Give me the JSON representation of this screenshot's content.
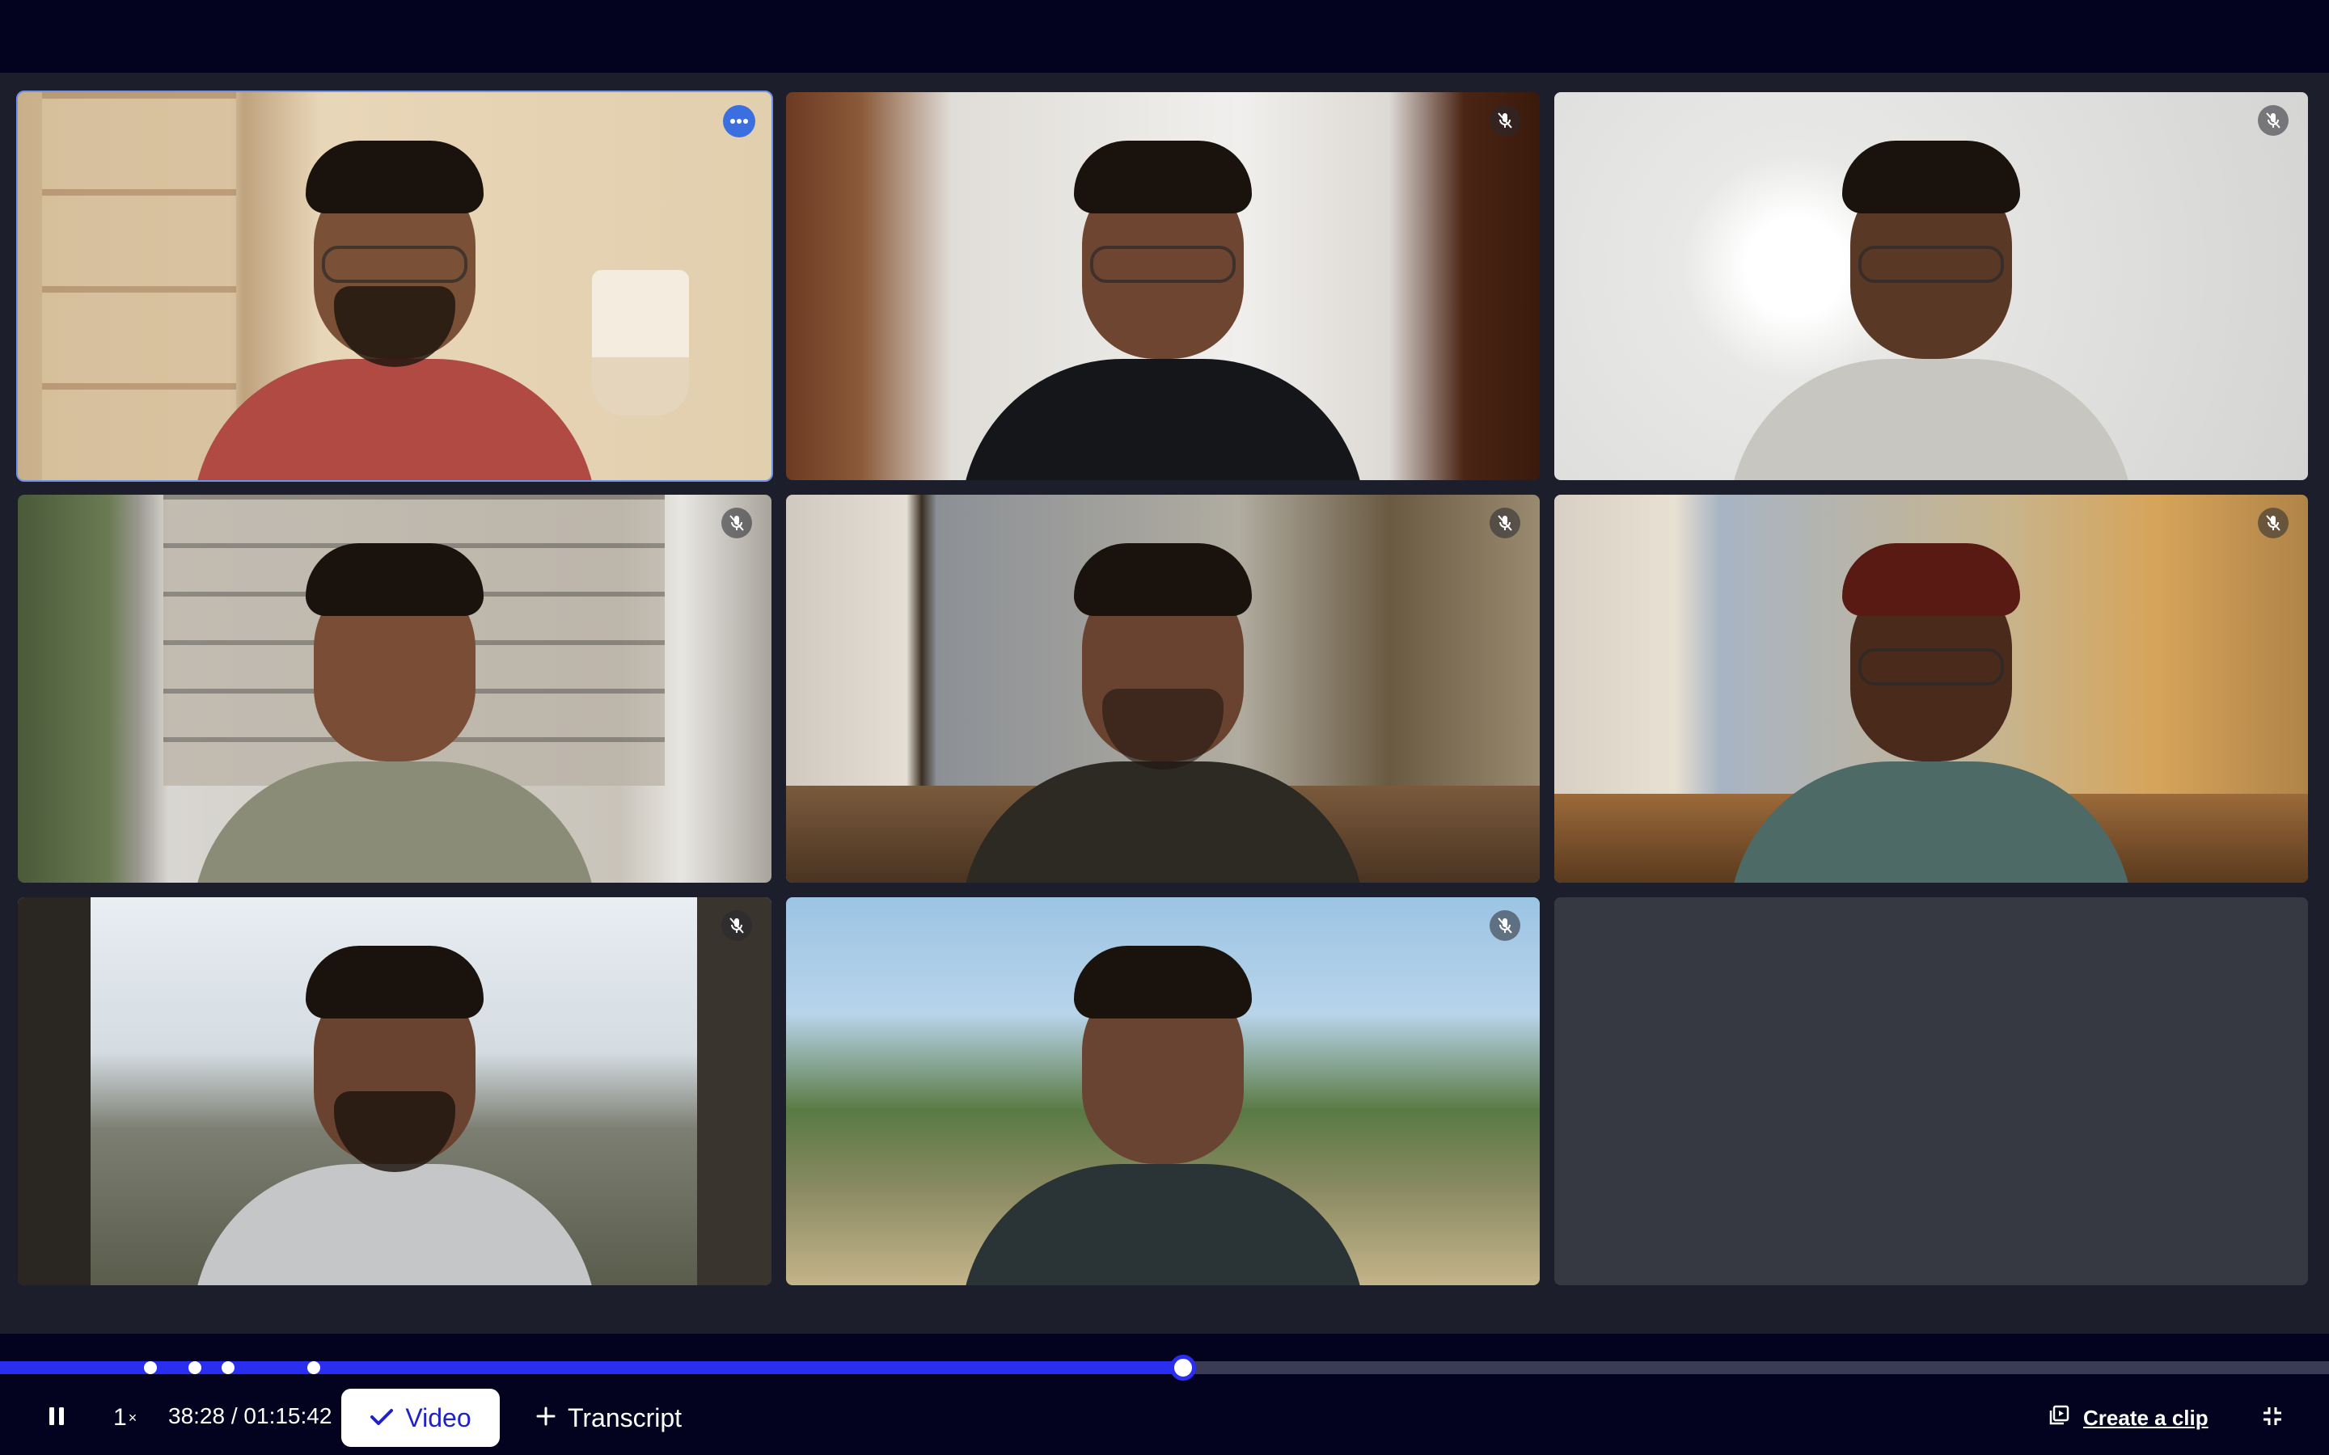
{
  "player": {
    "current_time": "38:28",
    "separator": "/",
    "duration": "01:15:42",
    "progress_fraction": 0.508,
    "markers": [
      0.0646,
      0.0837,
      0.0979,
      0.1348
    ],
    "speed_value": "1",
    "speed_suffix": "×"
  },
  "toolbar": {
    "pause_icon": "pause-icon",
    "video_label": "Video",
    "transcript_label": "Transcript",
    "create_clip_label": "Create a clip",
    "fullscreen_icon": "exit-fullscreen-icon"
  },
  "colors": {
    "accent": "#2a2ef0",
    "active_tile_border": "#6f93e8",
    "background": "#03031f"
  },
  "participants": [
    {
      "id": "p1",
      "active": true,
      "muted": false,
      "backdrop": "wooden shelf room",
      "shirt": "red"
    },
    {
      "id": "p2",
      "active": false,
      "muted": true,
      "backdrop": "blurred doorway",
      "shirt": "black"
    },
    {
      "id": "p3",
      "active": false,
      "muted": true,
      "backdrop": "bright white room",
      "shirt": "light grey"
    },
    {
      "id": "p4",
      "active": false,
      "muted": true,
      "backdrop": "library bookshelf",
      "shirt": "olive"
    },
    {
      "id": "p5",
      "active": false,
      "muted": true,
      "backdrop": "cafe window",
      "shirt": "checked dark"
    },
    {
      "id": "p6",
      "active": false,
      "muted": true,
      "backdrop": "street cafe",
      "shirt": "teal"
    },
    {
      "id": "p7",
      "active": false,
      "muted": true,
      "backdrop": "glass cabin landscape",
      "shirt": "white"
    },
    {
      "id": "p8",
      "active": false,
      "muted": true,
      "backdrop": "tropical beach",
      "shirt": "dark"
    }
  ]
}
